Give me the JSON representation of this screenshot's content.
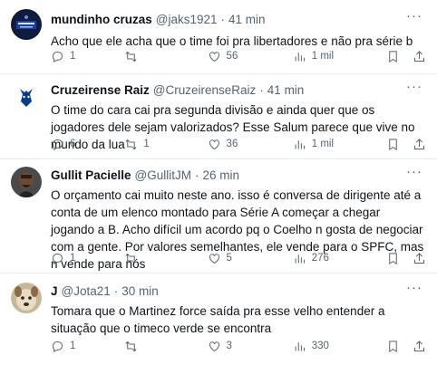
{
  "tweets": [
    {
      "name": "mundinho cruzas",
      "handle": "@jaks1921",
      "time": "41 min",
      "text": "Acho que ele acha que o time foi pra libertadores e não pra série b",
      "replies": "1",
      "retweets": "",
      "likes": "56",
      "views": "1 mil"
    },
    {
      "name": "Cruzeirense Raiz",
      "handle": "@CruzeirenseRaiz",
      "time": "41 min",
      "text": "O time do cara cai pra segunda divisão e ainda quer que os jogadores dele sejam valorizados? Esse Salum parece que vive no mundo da lua",
      "replies": "6",
      "retweets": "1",
      "likes": "36",
      "views": "1 mil"
    },
    {
      "name": "Gullit Pacielle",
      "handle": "@GullitJM",
      "time": "26 min",
      "text": "O orçamento  cai muito neste ano. isso é conversa de dirigente até a conta de um elenco montado para Série A começar a chegar jogando a B. Acho difícil um acordo pq o Coelho n gosta de negociar com a gente. Por valores semelhantes, ele vende para o SPFC, mas n vende para nós",
      "replies": "1",
      "retweets": "",
      "likes": "5",
      "views": "276"
    },
    {
      "name": "J",
      "handle": "@Jota21",
      "time": "30 min",
      "text": "Tomara que o Martinez force saída pra esse velho entender a situação que o timeco verde se encontra",
      "replies": "1",
      "retweets": "",
      "likes": "3",
      "views": "330"
    }
  ],
  "ui": {
    "dot": "·",
    "more_icon": "more-icon"
  }
}
